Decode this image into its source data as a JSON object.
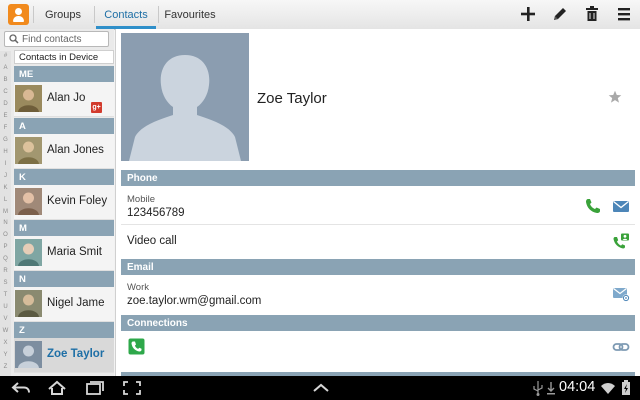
{
  "header": {
    "tabs": [
      {
        "label": "Groups",
        "active": false
      },
      {
        "label": "Contacts",
        "active": true
      },
      {
        "label": "Favourites",
        "active": false
      }
    ],
    "actions": [
      "add-icon",
      "edit-icon",
      "delete-icon",
      "menu-icon"
    ],
    "accent_color": "#2f8fc9"
  },
  "sidebar": {
    "search_placeholder": "Find contacts",
    "source_label": "Contacts in Device",
    "alpha_index": [
      "#",
      "A",
      "B",
      "C",
      "D",
      "E",
      "F",
      "G",
      "H",
      "I",
      "J",
      "K",
      "L",
      "M",
      "N",
      "O",
      "P",
      "Q",
      "R",
      "S",
      "T",
      "U",
      "V",
      "W",
      "X",
      "Y",
      "Z"
    ],
    "groups": [
      {
        "letter": "ME",
        "contacts": [
          {
            "name": "Alan Jo",
            "badge": "g+"
          }
        ]
      },
      {
        "letter": "A",
        "contacts": [
          {
            "name": "Alan Jones"
          }
        ]
      },
      {
        "letter": "K",
        "contacts": [
          {
            "name": "Kevin Foley"
          }
        ]
      },
      {
        "letter": "M",
        "contacts": [
          {
            "name": "Maria Smit"
          }
        ]
      },
      {
        "letter": "N",
        "contacts": [
          {
            "name": "Nigel Jame"
          }
        ]
      },
      {
        "letter": "Z",
        "contacts": [
          {
            "name": "Zoe Taylor",
            "selected": true
          }
        ]
      }
    ],
    "header_color": "#8aa3b4"
  },
  "detail": {
    "name": "Zoe Taylor",
    "sections": {
      "phone": "Phone",
      "email": "Email",
      "connections": "Connections"
    },
    "phone": {
      "label": "Mobile",
      "number": "123456789"
    },
    "video_call_label": "Video call",
    "email": {
      "label": "Work",
      "address": "zoe.taylor.wm@gmail.com"
    }
  },
  "system_bar": {
    "time": "04:04"
  }
}
